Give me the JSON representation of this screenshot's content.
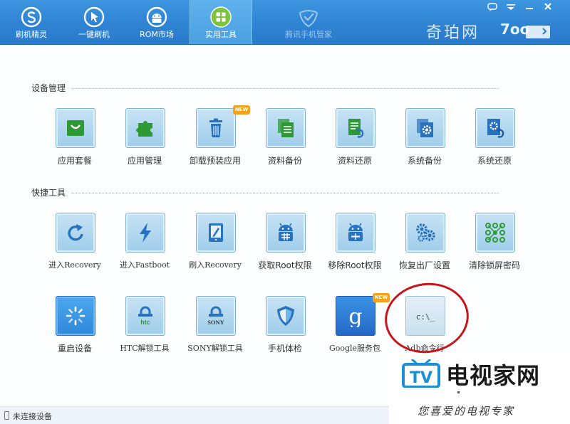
{
  "header": {
    "tabs": [
      {
        "label": "刷机精灵",
        "icon": "s-logo-icon"
      },
      {
        "label": "一键刷机",
        "icon": "cursor-arrow-icon"
      },
      {
        "label": "ROM市场",
        "icon": "android-icon"
      },
      {
        "label": "实用工具",
        "icon": "grid-tools-icon",
        "active": true
      },
      {
        "label": "腾讯手机管家",
        "icon": "shield-check-icon",
        "disabled": true
      }
    ],
    "brand": "奇珀网",
    "brand_logo": "7oo"
  },
  "sections": {
    "device": {
      "title": "设备管理",
      "tools": [
        {
          "label": "应用套餐",
          "icon": "shopping-bag-icon"
        },
        {
          "label": "应用管理",
          "icon": "puzzle-icon"
        },
        {
          "label": "卸载预装应用",
          "icon": "trash-icon",
          "badge": "NEW"
        },
        {
          "label": "资料备份",
          "icon": "document-copy-icon"
        },
        {
          "label": "资料还原",
          "icon": "document-restore-icon"
        },
        {
          "label": "系统备份",
          "icon": "gear-copy-icon"
        },
        {
          "label": "系统还原",
          "icon": "gear-restore-icon"
        }
      ]
    },
    "quick": {
      "title": "快捷工具",
      "tools": [
        {
          "label": "进入Recovery",
          "icon": "refresh-icon"
        },
        {
          "label": "进入Fastboot",
          "icon": "lightning-icon"
        },
        {
          "label": "刷入Recovery",
          "icon": "tablet-edit-icon"
        },
        {
          "label": "获取Root权限",
          "icon": "android-root-icon"
        },
        {
          "label": "移除Root权限",
          "icon": "android-unroot-icon"
        },
        {
          "label": "恢复出厂设置",
          "icon": "gears-icon"
        },
        {
          "label": "清除锁屏密码",
          "icon": "pattern-lock-icon"
        },
        {
          "label": "重启设备",
          "icon": "spinner-icon"
        },
        {
          "label": "HTC解锁工具",
          "icon": "htc-lock-icon",
          "brand_text": "htc"
        },
        {
          "label": "SONY解锁工具",
          "icon": "sony-lock-icon",
          "brand_text": "SONY"
        },
        {
          "label": "手机体检",
          "icon": "shield-icon"
        },
        {
          "label": "Google服务包",
          "icon": "google-g-icon",
          "badge": "NEW",
          "glyph": "g"
        },
        {
          "label": "Adb命令行",
          "icon": "terminal-icon",
          "glyph": "c:\\_"
        }
      ]
    }
  },
  "watermark": {
    "tv_text": "TV",
    "title": "电视家网",
    "slogan": "您喜爱的电视专家"
  },
  "status": {
    "text": "未连接设备"
  },
  "colors": {
    "header_blue": "#2f83d3",
    "tile_blue": "#9fcdea",
    "icon_green": "#2d9a35",
    "icon_blue": "#2872bf",
    "annotation_red": "#c8141b"
  }
}
